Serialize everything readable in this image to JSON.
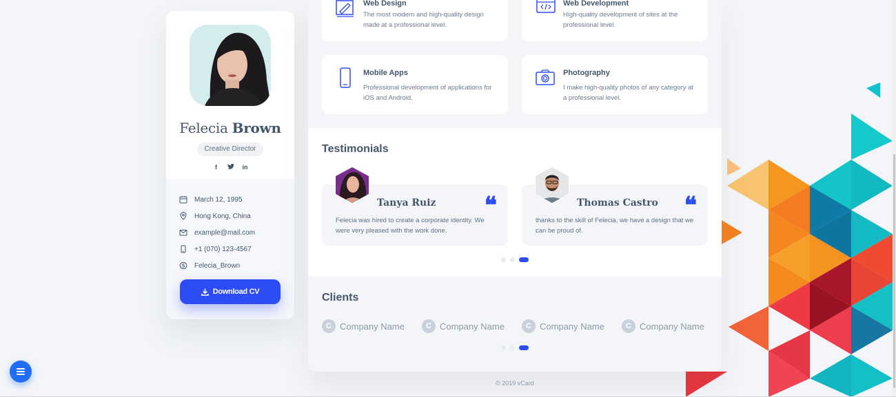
{
  "profile": {
    "first_name": "Felecia",
    "last_name": "Brown",
    "role": "Creative Director",
    "socials": [
      "f",
      "t",
      "in"
    ],
    "info": [
      {
        "icon": "calendar-icon",
        "text": "March 12, 1995"
      },
      {
        "icon": "location-icon",
        "text": "Hong Kong, China"
      },
      {
        "icon": "mail-icon",
        "text": "example@mail.com"
      },
      {
        "icon": "phone-icon",
        "text": "+1 (070) 123-4567"
      },
      {
        "icon": "skype-icon",
        "text": "Felecia_Brown"
      }
    ],
    "download_label": "Download CV"
  },
  "services": [
    {
      "title": "Web Design",
      "desc": "The most modern and high-quality design made at a professional level.",
      "icon": "web-design-icon"
    },
    {
      "title": "Web Development",
      "desc": "High-quality development of sites at the professional level.",
      "icon": "web-development-icon"
    },
    {
      "title": "Mobile Apps",
      "desc": "Professional development of applications for iOS and Android.",
      "icon": "mobile-icon"
    },
    {
      "title": "Photography",
      "desc": "I make high-quality photos of any category at a professional level.",
      "icon": "camera-icon"
    }
  ],
  "testimonials": {
    "title": "Testimonials",
    "items": [
      {
        "name": "Tanya Ruiz",
        "text": "Felecia was hired to create a corporate identity. We were very pleased with the work done."
      },
      {
        "name": "Thomas Castro",
        "text": "thanks to the skill of Felecia, we have a design that we can be proud of."
      }
    ],
    "quote_mark": "“"
  },
  "clients": {
    "title": "Clients",
    "items": [
      {
        "badge": "C",
        "name": "Company Name"
      },
      {
        "badge": "C",
        "name": "Company Name"
      },
      {
        "badge": "C",
        "name": "Company Name"
      },
      {
        "badge": "C",
        "name": "Company Name"
      }
    ]
  },
  "footer": {
    "text": "© 2019 vCard"
  },
  "colors": {
    "accent": "#2d4cf5",
    "text": "#44566c",
    "background": "#f3f5f8"
  }
}
